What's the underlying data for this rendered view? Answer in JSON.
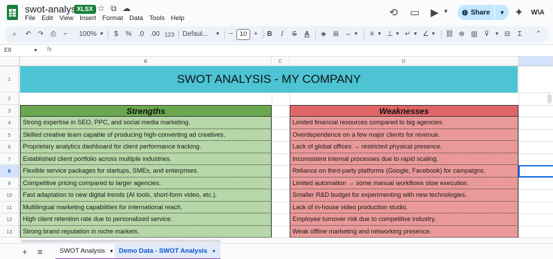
{
  "app": {
    "title": "swot-analysis",
    "badge": "XLSX",
    "menus": [
      "File",
      "Edit",
      "View",
      "Insert",
      "Format",
      "Data",
      "Tools",
      "Help"
    ],
    "share_label": "Share",
    "avatar_text": "W\\A"
  },
  "toolbar": {
    "zoom": "100%",
    "currency": "$",
    "percent": "%",
    "dec_decrease": ".0",
    "dec_increase": ".00",
    "format_123": "123",
    "font": "Defaul...",
    "font_size": "10"
  },
  "formula_bar": {
    "cell_ref": "E8",
    "fx": "fx"
  },
  "grid": {
    "columns": [
      "B",
      "C",
      "D"
    ],
    "rows": [
      "1",
      "2",
      "3",
      "4",
      "5",
      "6",
      "7",
      "8",
      "9",
      "10",
      "11",
      "12",
      "13"
    ],
    "title": "SWOT ANALYSIS - MY COMPANY",
    "strengths": {
      "heading": "Strengths",
      "items": [
        "Strong expertise in SEO, PPC, and social media marketing.",
        "Skilled creative team capable of producing high-converting ad creatives.",
        "Proprietary analytics dashboard for client performance tracking.",
        "Established client portfolio across multiple industries.",
        "Flexible service packages for startups, SMEs, and enterprises.",
        "Competitive pricing compared to larger agencies.",
        "Fast adaptation to new digital trends (AI tools, short-form video, etc.).",
        "Multilingual marketing capabilities for international reach.",
        "High client retention rate due to personalized service.",
        "Strong brand reputation in niche markets."
      ]
    },
    "weaknesses": {
      "heading": "Weaknesses",
      "items": [
        "Limited financial resources compared to big agencies.",
        "Overdependence on a few major clients for revenue.",
        "Lack of global offices → restricted physical presence.",
        "Inconsistent internal processes due to rapid scaling.",
        "Reliance on third-party platforms (Google, Facebook) for campaigns.",
        "Limited automation → some manual workflows slow execution.",
        "Smaller R&D budget for experimenting with new technologies.",
        "Lack of in-house video production studio.",
        "Employee turnover risk due to competitive industry.",
        "Weak offline marketing and networking presence."
      ]
    }
  },
  "sheets": {
    "tabs": [
      {
        "label": "SWOT Analysis",
        "active": false
      },
      {
        "label": "Demo Data - SWOT Analysis",
        "active": true
      }
    ]
  },
  "colors": {
    "banner": "#4cc4d4",
    "strengths_header": "#6aa84f",
    "strengths_cell": "#b6d7a8",
    "weaknesses_header": "#e06666",
    "weaknesses_cell": "#ea9999",
    "share": "#c2e7ff"
  }
}
